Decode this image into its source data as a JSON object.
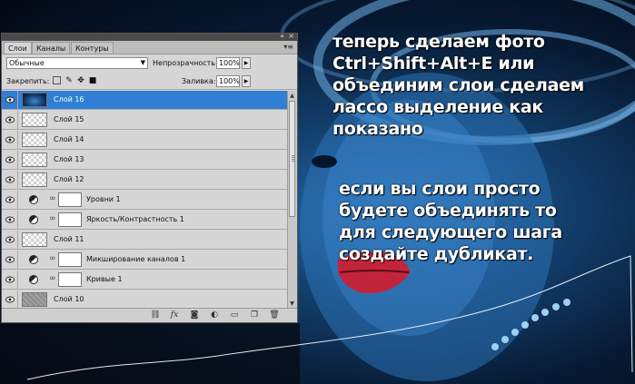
{
  "panel": {
    "tabs": [
      {
        "label": "Слои",
        "active": true
      },
      {
        "label": "Каналы",
        "active": false
      },
      {
        "label": "Контуры",
        "active": false
      }
    ],
    "blend_mode": "Обычные",
    "opacity_label": "Непрозрачность:",
    "opacity_value": "100%",
    "lock_label": "Закрепить:",
    "fill_label": "Заливка:",
    "fill_value": "100%",
    "layers": [
      {
        "name": "Слой 16",
        "kind": "photo",
        "selected": true
      },
      {
        "name": "Слой 15",
        "kind": "transparent"
      },
      {
        "name": "Слой 14",
        "kind": "transparent"
      },
      {
        "name": "Слой 13",
        "kind": "transparent"
      },
      {
        "name": "Слой 12",
        "kind": "transparent"
      },
      {
        "name": "Уровни 1",
        "kind": "adjustment"
      },
      {
        "name": "Яркость/Контрастность 1",
        "kind": "adjustment"
      },
      {
        "name": "Слой 11",
        "kind": "transparent"
      },
      {
        "name": "Микширование каналов 1",
        "kind": "adjustment"
      },
      {
        "name": "Кривые 1",
        "kind": "adjustment"
      },
      {
        "name": "Слой 10",
        "kind": "gray"
      }
    ],
    "footer_icons": [
      "link-icon",
      "fx-icon",
      "add-mask-icon",
      "adjustment-icon",
      "group-icon",
      "new-layer-icon",
      "trash-icon"
    ]
  },
  "caption": {
    "block1": "теперь сделаем фото\nCtrl+Shift+Alt+E или\nобъединим слои сделаем\nлассо выделение как\nпоказано",
    "block2": "если вы слои просто\nбудете объединять то\nдля следующего шага\nсоздайте дубликат."
  },
  "colors": {
    "selected_layer": "#2f7fd4",
    "panel_bg": "#d6d6d6"
  }
}
